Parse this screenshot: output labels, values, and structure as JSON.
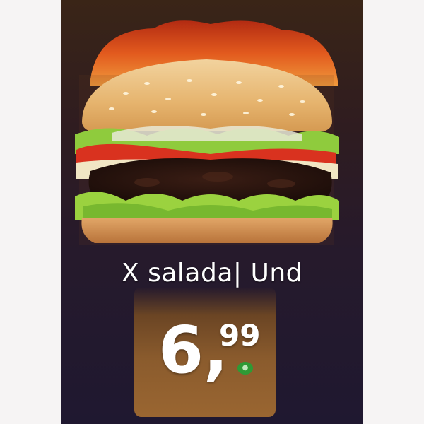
{
  "product": {
    "name": "X salada| Und",
    "price_integer": "6,",
    "price_decimal": "99"
  },
  "icons": {
    "currency_badge": "currency-badge-icon"
  },
  "colors": {
    "background": "#261a2c",
    "price_tag": "#8a5b2d",
    "currency_badge": "#2e9a35",
    "text": "#ffffff"
  }
}
